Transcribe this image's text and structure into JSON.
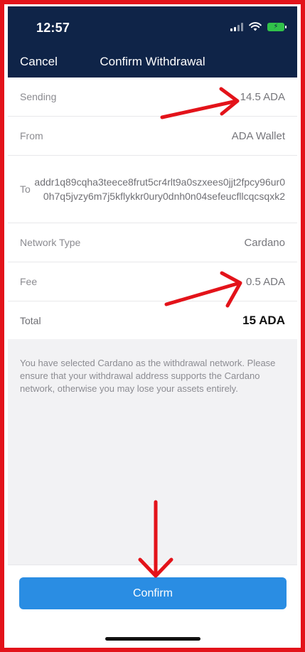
{
  "status_bar": {
    "time": "12:57"
  },
  "nav": {
    "cancel_label": "Cancel",
    "title": "Confirm Withdrawal"
  },
  "details": {
    "sending": {
      "label": "Sending",
      "value": "14.5 ADA"
    },
    "from": {
      "label": "From",
      "value": "ADA Wallet"
    },
    "to": {
      "label": "To",
      "value": "addr1q89cqha3teece8frut5cr4rlt9a0szxees0jjt2fpcy96ur00h7q5jvzy6m7j5kflykkr0ury0dnh0n04sefeucfllcqcsqxk2"
    },
    "network_type": {
      "label": "Network Type",
      "value": "Cardano"
    },
    "fee": {
      "label": "Fee",
      "value": "0.5 ADA"
    },
    "total": {
      "label": "Total",
      "value": "15 ADA"
    }
  },
  "notice": "You have selected Cardano as the withdrawal network. Please ensure that your withdrawal address supports the Cardano network, otherwise you may lose your assets entirely.",
  "confirm_label": "Confirm",
  "colors": {
    "header_bg": "#0f2448",
    "confirm_bg": "#2a8de3",
    "annotation_red": "#e3131a",
    "battery_green": "#31c24a"
  }
}
